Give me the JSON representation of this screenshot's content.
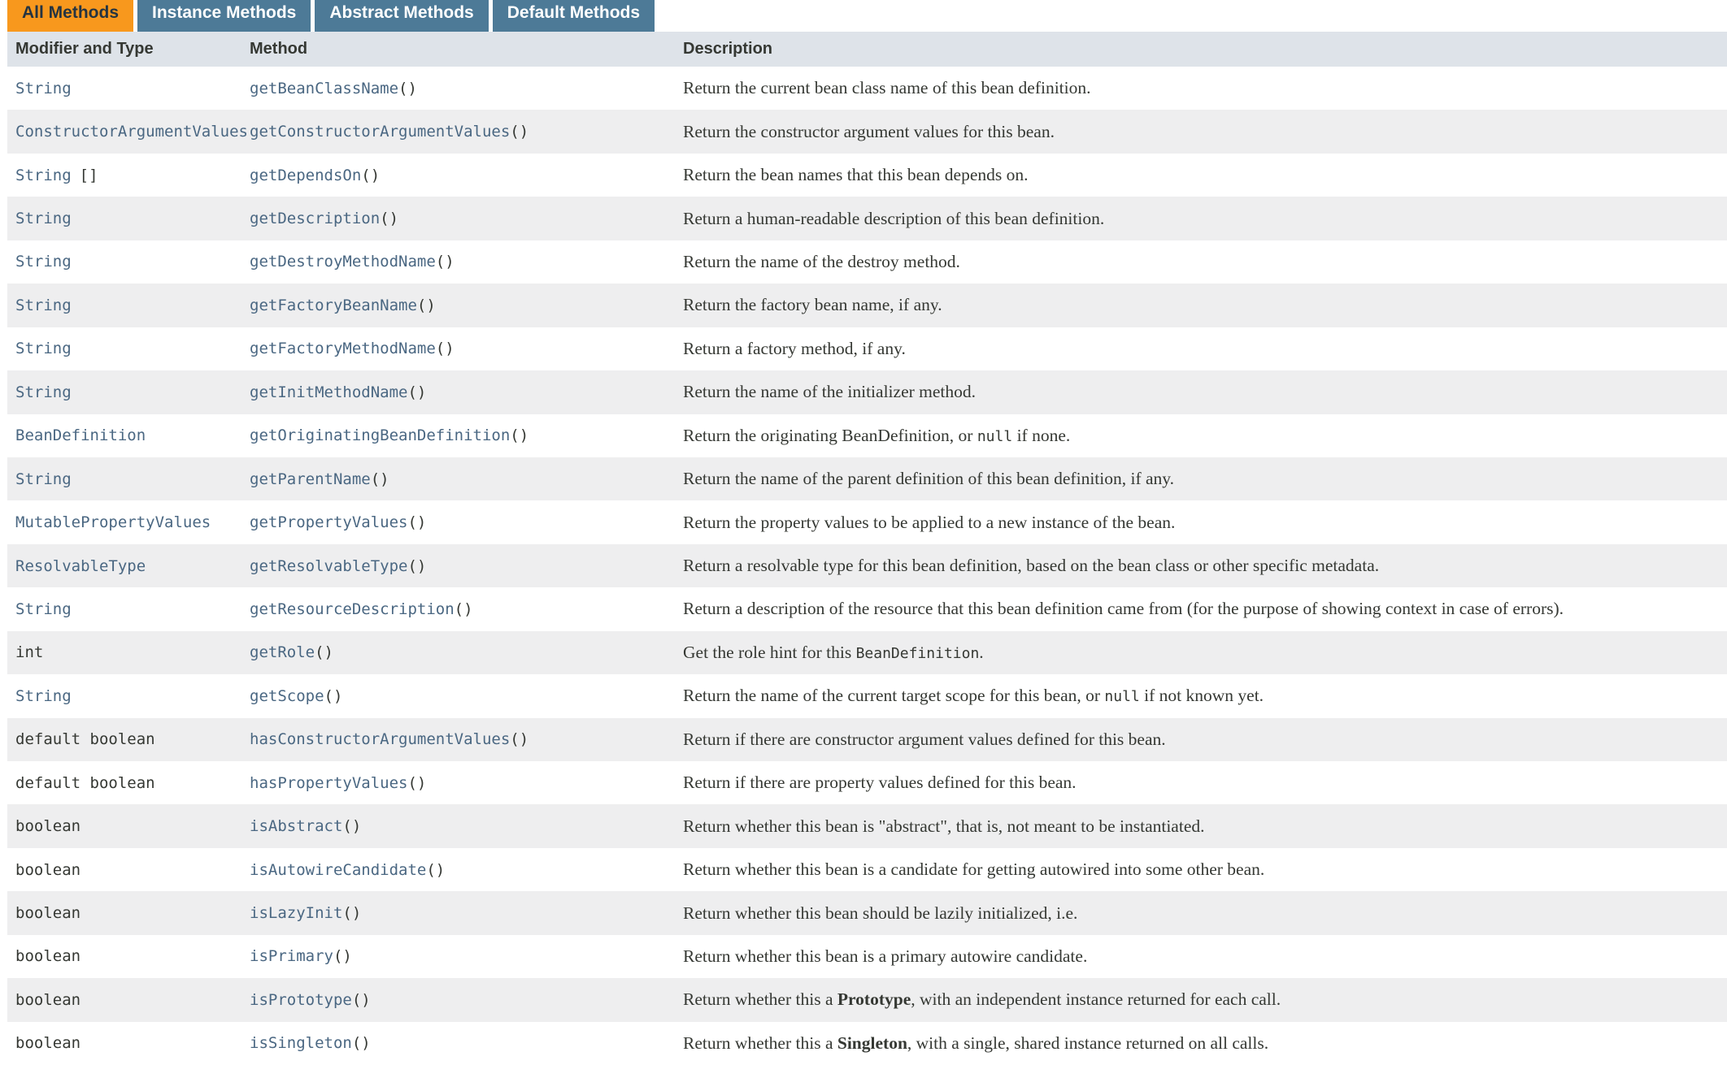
{
  "tabs": [
    {
      "label": "All Methods",
      "active": true
    },
    {
      "label": "Instance Methods",
      "active": false
    },
    {
      "label": "Abstract Methods",
      "active": false
    },
    {
      "label": "Default Methods",
      "active": false
    }
  ],
  "columns": {
    "type": "Modifier and Type",
    "method": "Method",
    "description": "Description"
  },
  "colors": {
    "active_tab": "#f8981d",
    "inactive_tab": "#4d7a97",
    "header_bg": "#dee3e9",
    "alt_row_bg": "#eeeeef",
    "link": "#4a6782",
    "text": "#353833"
  },
  "rows": [
    {
      "type": "String",
      "type_link": true,
      "method": "getBeanClassName",
      "parens": "()",
      "desc": [
        {
          "t": "Return the current bean class name of this bean definition."
        }
      ]
    },
    {
      "type": "ConstructorArgumentValues",
      "type_link": true,
      "method": "getConstructorArgumentValues",
      "parens": "()",
      "desc": [
        {
          "t": "Return the constructor argument values for this bean."
        }
      ]
    },
    {
      "type": "String",
      "type_link": true,
      "type_suffix": "[]",
      "method": "getDependsOn",
      "parens": "()",
      "desc": [
        {
          "t": "Return the bean names that this bean depends on."
        }
      ]
    },
    {
      "type": "String",
      "type_link": true,
      "method": "getDescription",
      "parens": "()",
      "desc": [
        {
          "t": "Return a human-readable description of this bean definition."
        }
      ]
    },
    {
      "type": "String",
      "type_link": true,
      "method": "getDestroyMethodName",
      "parens": "()",
      "desc": [
        {
          "t": "Return the name of the destroy method."
        }
      ]
    },
    {
      "type": "String",
      "type_link": true,
      "method": "getFactoryBeanName",
      "parens": "()",
      "desc": [
        {
          "t": "Return the factory bean name, if any."
        }
      ]
    },
    {
      "type": "String",
      "type_link": true,
      "method": "getFactoryMethodName",
      "parens": "()",
      "desc": [
        {
          "t": "Return a factory method, if any."
        }
      ]
    },
    {
      "type": "String",
      "type_link": true,
      "method": "getInitMethodName",
      "parens": "()",
      "desc": [
        {
          "t": "Return the name of the initializer method."
        }
      ]
    },
    {
      "type": "BeanDefinition",
      "type_link": true,
      "method": "getOriginatingBeanDefinition",
      "parens": "()",
      "desc": [
        {
          "t": "Return the originating BeanDefinition, or "
        },
        {
          "t": "null",
          "code": true
        },
        {
          "t": " if none."
        }
      ]
    },
    {
      "type": "String",
      "type_link": true,
      "method": "getParentName",
      "parens": "()",
      "desc": [
        {
          "t": "Return the name of the parent definition of this bean definition, if any."
        }
      ]
    },
    {
      "type": "MutablePropertyValues",
      "type_link": true,
      "method": "getPropertyValues",
      "parens": "()",
      "desc": [
        {
          "t": "Return the property values to be applied to a new instance of the bean."
        }
      ]
    },
    {
      "type": "ResolvableType",
      "type_link": true,
      "method": "getResolvableType",
      "parens": "()",
      "desc": [
        {
          "t": "Return a resolvable type for this bean definition, based on the bean class or other specific metadata."
        }
      ]
    },
    {
      "type": "String",
      "type_link": true,
      "method": "getResourceDescription",
      "parens": "()",
      "desc": [
        {
          "t": "Return a description of the resource that this bean definition came from (for the purpose of showing context in case of errors)."
        }
      ]
    },
    {
      "type": "int",
      "type_link": false,
      "method": "getRole",
      "parens": "()",
      "desc": [
        {
          "t": "Get the role hint for this "
        },
        {
          "t": "BeanDefinition",
          "code": true
        },
        {
          "t": "."
        }
      ]
    },
    {
      "type": "String",
      "type_link": true,
      "method": "getScope",
      "parens": "()",
      "desc": [
        {
          "t": "Return the name of the current target scope for this bean, or "
        },
        {
          "t": "null",
          "code": true
        },
        {
          "t": " if not known yet."
        }
      ]
    },
    {
      "type": "default boolean",
      "type_link": false,
      "method": "hasConstructorArgumentValues",
      "parens": "()",
      "desc": [
        {
          "t": "Return if there are constructor argument values defined for this bean."
        }
      ]
    },
    {
      "type": "default boolean",
      "type_link": false,
      "method": "hasPropertyValues",
      "parens": "()",
      "desc": [
        {
          "t": "Return if there are property values defined for this bean."
        }
      ]
    },
    {
      "type": "boolean",
      "type_link": false,
      "method": "isAbstract",
      "parens": "()",
      "desc": [
        {
          "t": "Return whether this bean is \"abstract\", that is, not meant to be instantiated."
        }
      ]
    },
    {
      "type": "boolean",
      "type_link": false,
      "method": "isAutowireCandidate",
      "parens": "()",
      "desc": [
        {
          "t": "Return whether this bean is a candidate for getting autowired into some other bean."
        }
      ]
    },
    {
      "type": "boolean",
      "type_link": false,
      "method": "isLazyInit",
      "parens": "()",
      "desc": [
        {
          "t": "Return whether this bean should be lazily initialized, i.e."
        }
      ]
    },
    {
      "type": "boolean",
      "type_link": false,
      "method": "isPrimary",
      "parens": "()",
      "desc": [
        {
          "t": "Return whether this bean is a primary autowire candidate."
        }
      ]
    },
    {
      "type": "boolean",
      "type_link": false,
      "method": "isPrototype",
      "parens": "()",
      "desc": [
        {
          "t": "Return whether this a "
        },
        {
          "t": "Prototype",
          "bold": true
        },
        {
          "t": ", with an independent instance returned for each call."
        }
      ]
    },
    {
      "type": "boolean",
      "type_link": false,
      "method": "isSingleton",
      "parens": "()",
      "desc": [
        {
          "t": "Return whether this a "
        },
        {
          "t": "Singleton",
          "bold": true
        },
        {
          "t": ", with a single, shared instance returned on all calls."
        }
      ]
    }
  ]
}
